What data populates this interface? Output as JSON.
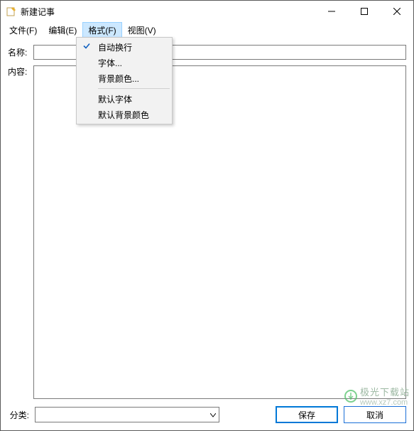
{
  "window": {
    "title": "新建记事"
  },
  "menubar": {
    "items": [
      "文件(F)",
      "编辑(E)",
      "格式(F)",
      "视图(V)"
    ],
    "activeIndex": 2
  },
  "labels": {
    "name": "名称:",
    "content": "内容:",
    "category": "分类:"
  },
  "inputs": {
    "nameValue": "",
    "contentValue": "",
    "categoryValue": ""
  },
  "buttons": {
    "save": "保存",
    "cancel": "取消"
  },
  "dropdown": {
    "items": [
      {
        "label": "自动换行",
        "checked": true
      },
      {
        "label": "字体...",
        "checked": false
      },
      {
        "label": "背景颜色...",
        "checked": false
      }
    ],
    "sepAfter": 2,
    "items2": [
      {
        "label": "默认字体",
        "checked": false
      },
      {
        "label": "默认背景颜色",
        "checked": false
      }
    ]
  },
  "watermark": {
    "text": "极光下载站",
    "url": "www.xz7.com"
  }
}
